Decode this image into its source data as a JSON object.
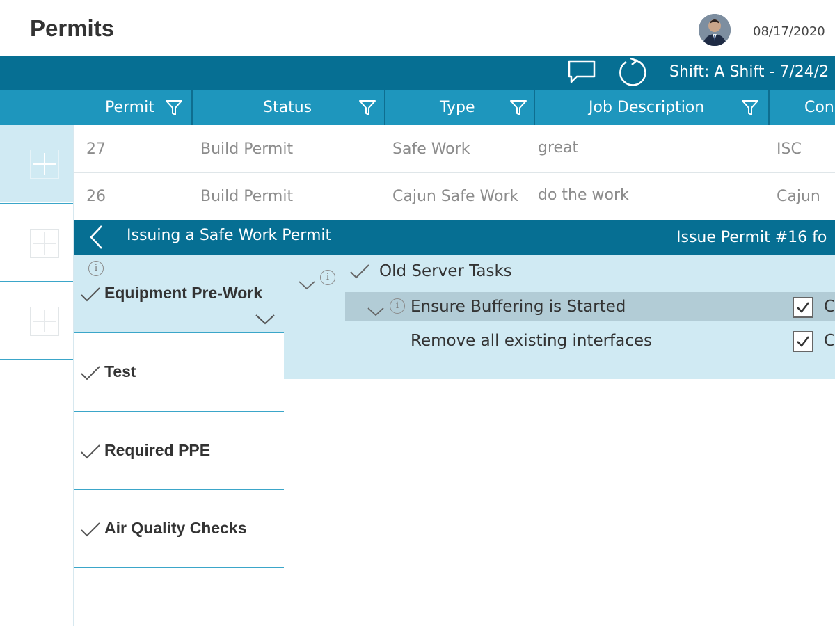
{
  "header": {
    "title": "Permits",
    "date": "08/17/2020"
  },
  "toolbar": {
    "shift_label": "Shift: A Shift - 7/24/2"
  },
  "columns": [
    {
      "label": "Permit"
    },
    {
      "label": "Status"
    },
    {
      "label": "Type"
    },
    {
      "label": "Job Description"
    },
    {
      "label": "Con"
    }
  ],
  "rows": [
    {
      "permit": "27",
      "status": "Build Permit",
      "type": "Safe Work",
      "job": "great",
      "con": "ISC"
    },
    {
      "permit": "26",
      "status": "Build Permit",
      "type": "Cajun Safe Work",
      "job": "do the work",
      "con": "Cajun"
    }
  ],
  "overlay": {
    "title": "Issuing a Safe Work Permit",
    "right_label": "Issue Permit #16 fo"
  },
  "steps": [
    {
      "label": "Equipment Pre-Work",
      "active": true
    },
    {
      "label": "Test"
    },
    {
      "label": "Required PPE"
    },
    {
      "label": "Air Quality Checks"
    }
  ],
  "tasks": {
    "group_label": "Old Server Tasks",
    "subtask_label": "Ensure Buffering is Started",
    "item_label": "Remove all existing interfaces",
    "checkbox_label_1": "C",
    "checkbox_label_2": "C"
  },
  "icons": {
    "info": "i"
  },
  "colors": {
    "toolbar": "#066f93",
    "column_header": "#1e96bd",
    "panel": "#d0eaf3",
    "highlight": "#b2ccd6"
  }
}
